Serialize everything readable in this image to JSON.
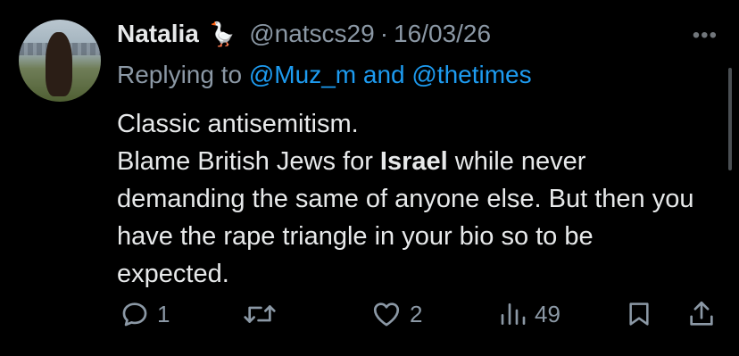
{
  "tweet": {
    "author_name": "Natalia",
    "author_emoji": "🪿",
    "handle": "@natscs29",
    "separator": "·",
    "date": "16/03/26",
    "more_label": "•••",
    "reply_prefix": "Replying to",
    "reply_mention_1": "@Muz_m",
    "reply_and": "and",
    "reply_mention_2": "@thetimes",
    "text_line1": "Classic antisemitism.",
    "text_line2_a": "Blame British Jews for ",
    "text_line2_bold": "Israel",
    "text_line2_b": " while never demanding the same of anyone else. But then you have the rape triangle in your bio so to be expected."
  },
  "actions": {
    "reply_count": "1",
    "retweet_count": "",
    "like_count": "2",
    "views_count": "49"
  },
  "colors": {
    "background": "#000000",
    "text": "#e7e9ea",
    "secondary": "#8b98a5",
    "accent": "#1d9bf0"
  },
  "icons": [
    "reply-icon",
    "retweet-icon",
    "like-icon",
    "views-icon",
    "bookmark-icon",
    "share-icon",
    "more-icon"
  ]
}
